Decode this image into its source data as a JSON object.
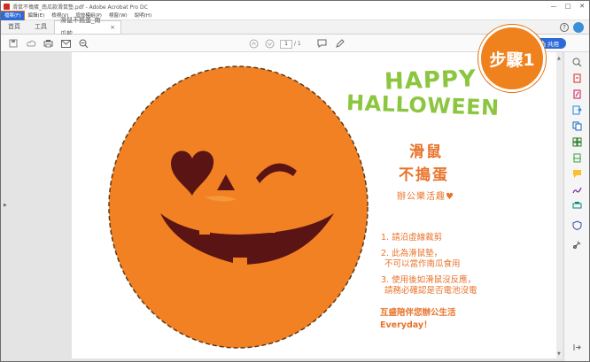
{
  "window": {
    "title": "滑鼠不搗蛋_南瓜款滑鼠墊.pdf - Adobe Acrobat Pro DC",
    "controls": {
      "minimize": "—",
      "maximize": "□",
      "close": "✕"
    }
  },
  "menu": {
    "items": [
      "檔案(F)",
      "編輯(E)",
      "檢視(V)",
      "增效模組(P)",
      "視窗(W)",
      "說明(H)"
    ]
  },
  "tabs": {
    "home": "首頁",
    "tools": "工具",
    "document": "滑鼠不搗蛋_南瓜款...",
    "close": "×"
  },
  "toolbar": {
    "page_current": "1",
    "page_total": "/ 1",
    "share_label": "共用",
    "icons": [
      "save-icon",
      "upload-icon",
      "print-icon",
      "email-icon",
      "zoom-out-icon",
      "page-up-icon",
      "page-down-icon",
      "comment-icon",
      "pen-icon"
    ]
  },
  "step_badge": "步驟1",
  "document": {
    "happy": "HAPPY",
    "halloween": "HALLOWEEN",
    "title_line1": "滑鼠",
    "title_line2": "不搗蛋",
    "subtitle": "辦公樂活趣",
    "heart": "♥",
    "instructions": [
      "1. 請沿虛線裁剪",
      "2. 此為滑鼠墊，",
      "不可以當作南瓜食用",
      "3. 使用後如滑鼠沒反應，",
      "請務必確認是否電池沒電"
    ],
    "closing_line1": "互盛陪伴您辦公生活",
    "closing_line2": "Everyday！"
  },
  "colors": {
    "pumpkin": "#f28123",
    "accent_orange": "#e8732a",
    "green": "#8cc63f",
    "face": "#5a1414",
    "share_blue": "#2e6bd6"
  }
}
